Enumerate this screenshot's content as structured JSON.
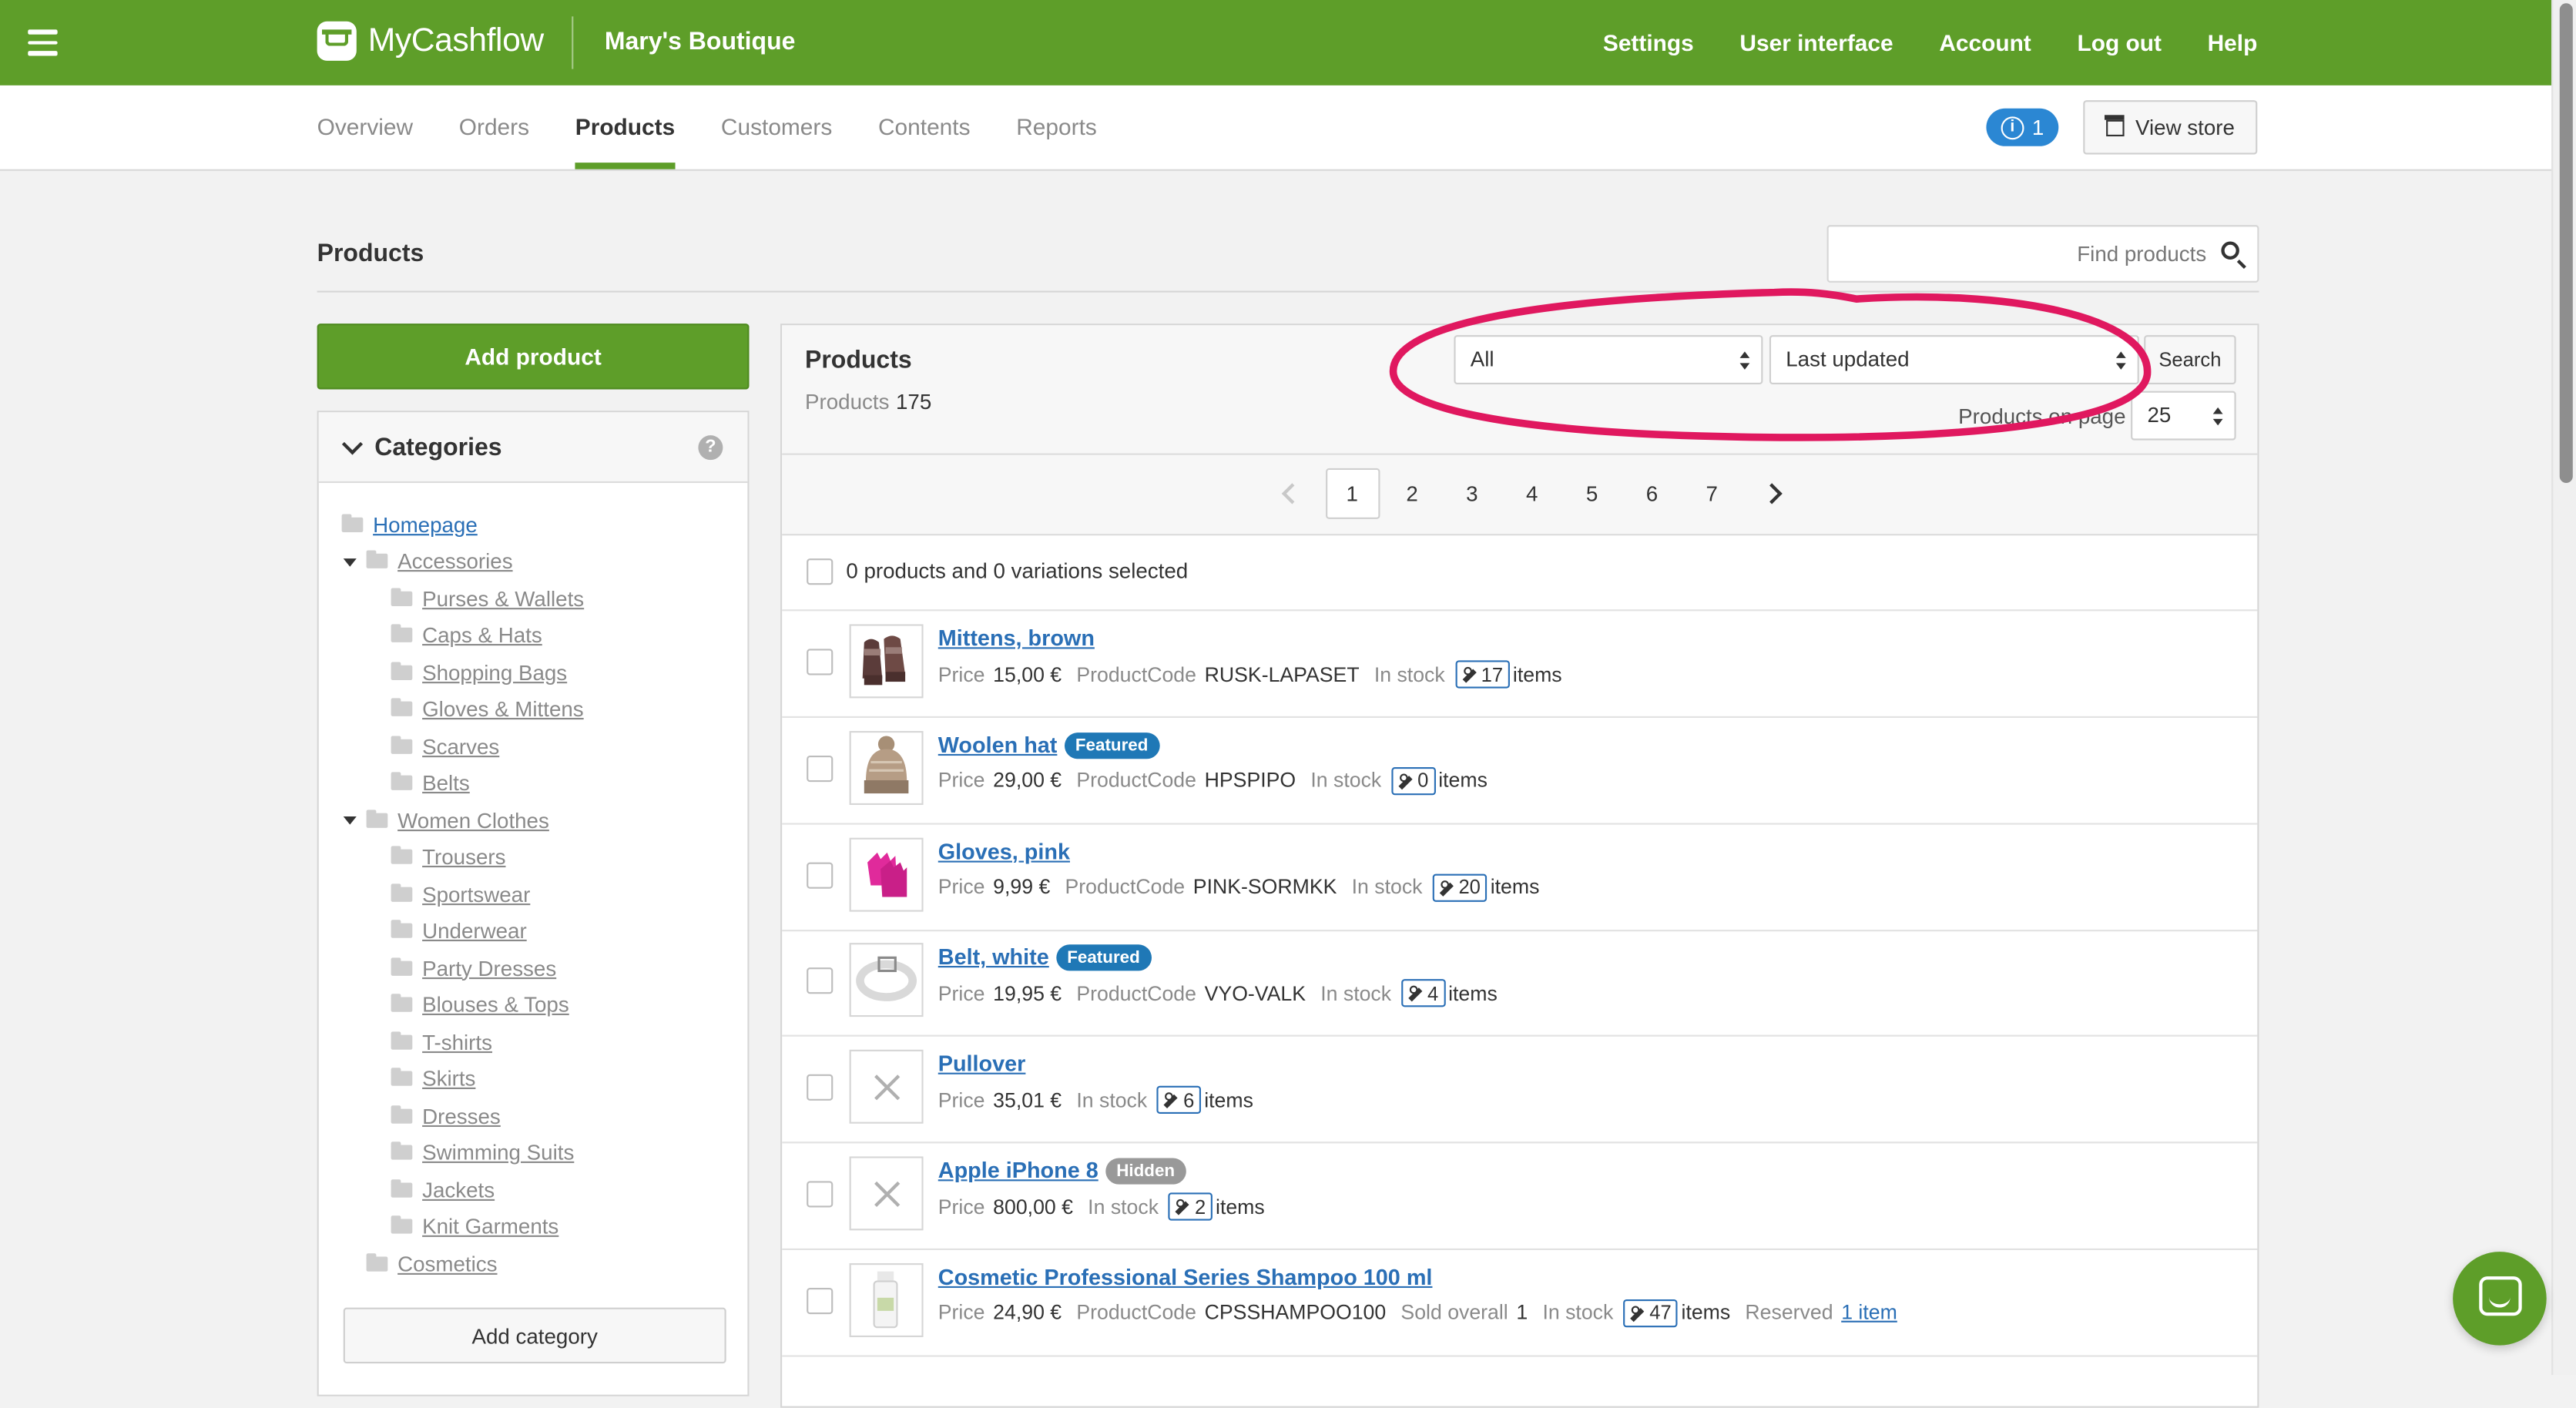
{
  "app": {
    "logo": "MyCashflow",
    "store_name": "Mary's Boutique"
  },
  "topnav": [
    "Settings",
    "User interface",
    "Account",
    "Log out",
    "Help"
  ],
  "subnav": {
    "tabs": [
      "Overview",
      "Orders",
      "Products",
      "Customers",
      "Contents",
      "Reports"
    ],
    "active": "Products",
    "notifications": "1",
    "view_store": "View store"
  },
  "page": {
    "title": "Products",
    "find_placeholder": "Find products"
  },
  "sidebar": {
    "add_product": "Add product",
    "categories_title": "Categories",
    "help": "?",
    "add_category": "Add category",
    "categories": [
      {
        "label": "Homepage",
        "level": 0,
        "home": true
      },
      {
        "label": "Accessories",
        "level": 1,
        "expanded": true
      },
      {
        "label": "Purses & Wallets",
        "level": 2
      },
      {
        "label": "Caps & Hats",
        "level": 2
      },
      {
        "label": "Shopping Bags",
        "level": 2
      },
      {
        "label": "Gloves & Mittens",
        "level": 2
      },
      {
        "label": "Scarves",
        "level": 2
      },
      {
        "label": "Belts",
        "level": 2
      },
      {
        "label": "Women Clothes",
        "level": 1,
        "expanded": true
      },
      {
        "label": "Trousers",
        "level": 2
      },
      {
        "label": "Sportswear",
        "level": 2
      },
      {
        "label": "Underwear",
        "level": 2
      },
      {
        "label": "Party Dresses",
        "level": 2
      },
      {
        "label": "Blouses & Tops",
        "level": 2
      },
      {
        "label": "T-shirts",
        "level": 2
      },
      {
        "label": "Skirts",
        "level": 2
      },
      {
        "label": "Dresses",
        "level": 2
      },
      {
        "label": "Swimming Suits",
        "level": 2
      },
      {
        "label": "Jackets",
        "level": 2
      },
      {
        "label": "Knit Garments",
        "level": 2
      },
      {
        "label": "Cosmetics",
        "level": 1
      }
    ]
  },
  "products_panel": {
    "title": "Products",
    "count_label": "Products",
    "count": "175",
    "filter_value": "All",
    "sort_value": "Last updated",
    "search_label": "Search",
    "per_page_label": "Products on page",
    "per_page_value": "25",
    "pages": [
      "1",
      "2",
      "3",
      "4",
      "5",
      "6",
      "7"
    ],
    "current_page": "1",
    "selection_text": "0 products and 0 variations selected",
    "labels": {
      "price": "Price",
      "code": "ProductCode",
      "stock": "In stock",
      "items": "items",
      "sold": "Sold overall",
      "reserved": "Reserved"
    },
    "products": [
      {
        "name": "Mittens, brown",
        "price": "15,00 €",
        "code": "RUSK-LAPASET",
        "stock": "17",
        "thumb": "mittens"
      },
      {
        "name": "Woolen hat",
        "badge": "Featured",
        "price": "29,00 €",
        "code": "HPSPIPO",
        "stock": "0",
        "thumb": "hat"
      },
      {
        "name": "Gloves, pink",
        "price": "9,99 €",
        "code": "PINK-SORMKK",
        "stock": "20",
        "thumb": "gloves"
      },
      {
        "name": "Belt, white",
        "badge": "Featured",
        "price": "19,95 €",
        "code": "VYO-VALK",
        "stock": "4",
        "thumb": "belt"
      },
      {
        "name": "Pullover",
        "price": "35,01 €",
        "stock": "6",
        "thumb": "none"
      },
      {
        "name": "Apple iPhone 8",
        "badge": "Hidden",
        "price": "800,00 €",
        "stock": "2",
        "thumb": "none"
      },
      {
        "name": "Cosmetic Professional Series Shampoo 100 ml",
        "price": "24,90 €",
        "code": "CPSSHAMPOO100",
        "sold": "1",
        "stock": "47",
        "reserved": "1 item",
        "thumb": "shampoo"
      }
    ]
  },
  "colors": {
    "brand_green": "#5e9e29",
    "link_blue": "#2a6fb6",
    "annotation_pink": "#e0185f"
  }
}
